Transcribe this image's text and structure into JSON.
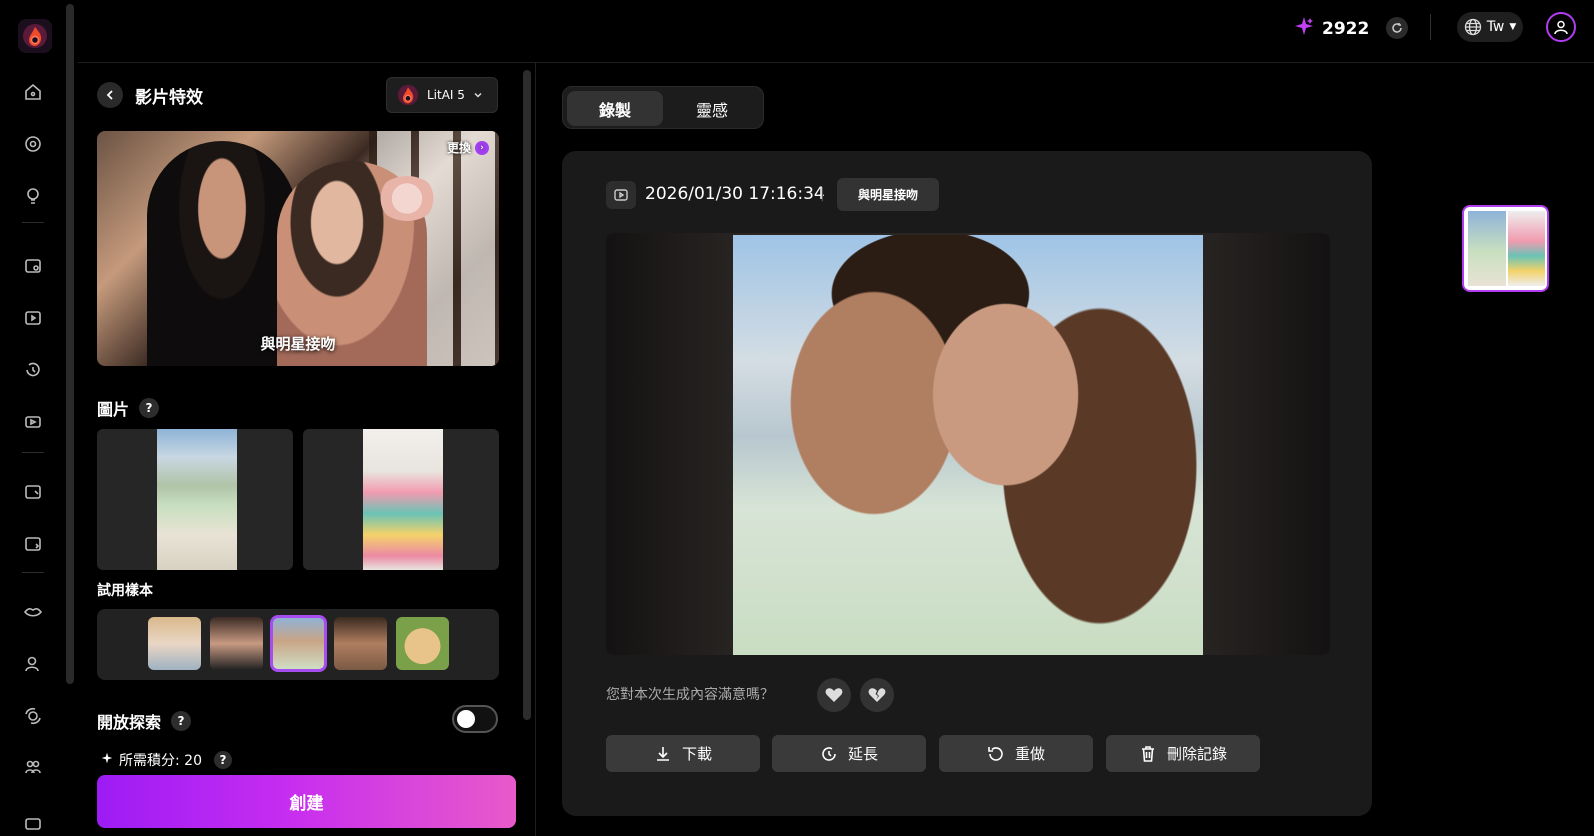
{
  "topbar": {
    "credits": "2922",
    "language": "Tw"
  },
  "panel": {
    "title": "影片特效",
    "model": "LitAI 5",
    "effect_card": {
      "change_label": "更換",
      "caption": "與明星接吻"
    },
    "images_label": "圖片",
    "samples_label": "試用樣本",
    "explore_label": "開放探索",
    "explore_enabled": false,
    "cost_label": "所需積分: 20",
    "create_label": "創建",
    "help_mark": "?"
  },
  "main": {
    "tabs": [
      "錄製",
      "靈感"
    ],
    "active_tab": 0,
    "record": {
      "timestamp": "2026/01/30 17:16:34",
      "separator": "|",
      "effect_tag": "與明星接吻",
      "feedback_question": "您對本次生成內容滿意嗎？",
      "actions": [
        "下載",
        "延長",
        "重做",
        "刪除記錄"
      ]
    }
  },
  "colors": {
    "accent": "#a23ff0",
    "create_gradient_start": "#9d1cf4",
    "create_gradient_end": "#e85ac9",
    "card_bg": "#1a1a1a"
  },
  "icons": {
    "rail": [
      "home-icon",
      "discover-icon",
      "idea-icon",
      "image-edit-icon",
      "video-icon",
      "history-icon",
      "video-effect-icon",
      "photo-effect-icon",
      "photo-enhance-icon",
      "lips-icon",
      "ai-avatar-icon",
      "face-swap-icon",
      "group-icon"
    ]
  }
}
